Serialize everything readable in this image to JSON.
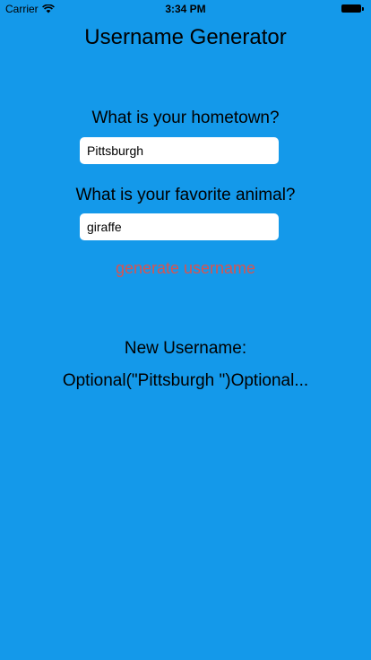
{
  "status_bar": {
    "carrier": "Carrier",
    "time": "3:34 PM"
  },
  "app": {
    "title": "Username Generator",
    "hometown_label": "What is your hometown?",
    "hometown_value": "Pittsburgh",
    "animal_label": "What is your favorite animal?",
    "animal_value": "giraffe",
    "generate_label": "generate username",
    "new_username_label": "New Username:",
    "result": "Optional(\"Pittsburgh \")Optional..."
  },
  "colors": {
    "background": "#1499ea",
    "generate_button": "#d9534f"
  }
}
